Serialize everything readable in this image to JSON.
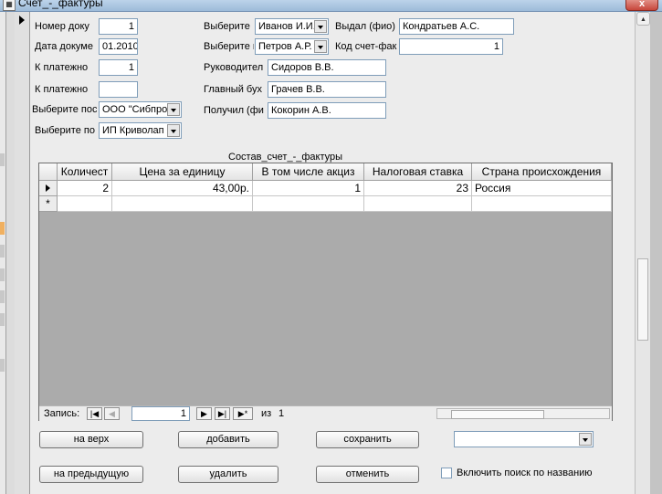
{
  "window": {
    "title": "Счет_-_фактуры",
    "close_label": "x"
  },
  "form": {
    "fields": {
      "nomer_label": "Номер доку",
      "nomer_value": "1",
      "data_label": "Дата докуме",
      "data_value": "01.2010",
      "k_plat1_label": "К платежно",
      "k_plat1_value": "1",
      "k_plat2_label": "К платежно",
      "k_plat2_value": "",
      "vyb_pos_label": "Выберите пос",
      "vyb_pos_value": "ООО \"Сибпро",
      "vyb_po_label": "Выберите по",
      "vyb_po_value": "ИП Криволап",
      "vyb1_label": "Выберите",
      "vyb1_value": "Иванов И.И.",
      "vydal_label": "Выдал (фио)",
      "vydal_value": "Кондратьев А.С.",
      "vyb2_label": "Выберите г",
      "vyb2_value": "Петров А.Р.",
      "kod_label": "Код счет-фак",
      "kod_value": "1",
      "ruk_label": "Руководител",
      "ruk_value": "Сидоров В.В.",
      "glbuh_label": "Главный бух",
      "glbuh_value": "Грачев В.В.",
      "poluchil_label": "Получил (фи",
      "poluchil_value": "Кокорин А.В."
    },
    "subform_title": "Состав_счет_-_фактуры",
    "table": {
      "columns": [
        "Количест",
        "Цена за единицу",
        "В том числе акциз",
        "Налоговая ставка",
        "Страна происхождения"
      ],
      "rows": [
        {
          "qty": "2",
          "price": "43,00р.",
          "excise": "1",
          "tax": "23",
          "country": "Россия"
        }
      ],
      "new_row_marker": "*"
    },
    "navigation": {
      "record_label": "Запись:",
      "current_record": "1",
      "of_label": "из",
      "total_records": "1"
    },
    "buttons": {
      "top": "на верх",
      "add": "добавить",
      "save": "сохранить",
      "prev": "на предыдущую",
      "delete": "удалить",
      "cancel": "отменить"
    },
    "search_combo_value": "",
    "search_checkbox_label": "Включить поиск по названию"
  }
}
